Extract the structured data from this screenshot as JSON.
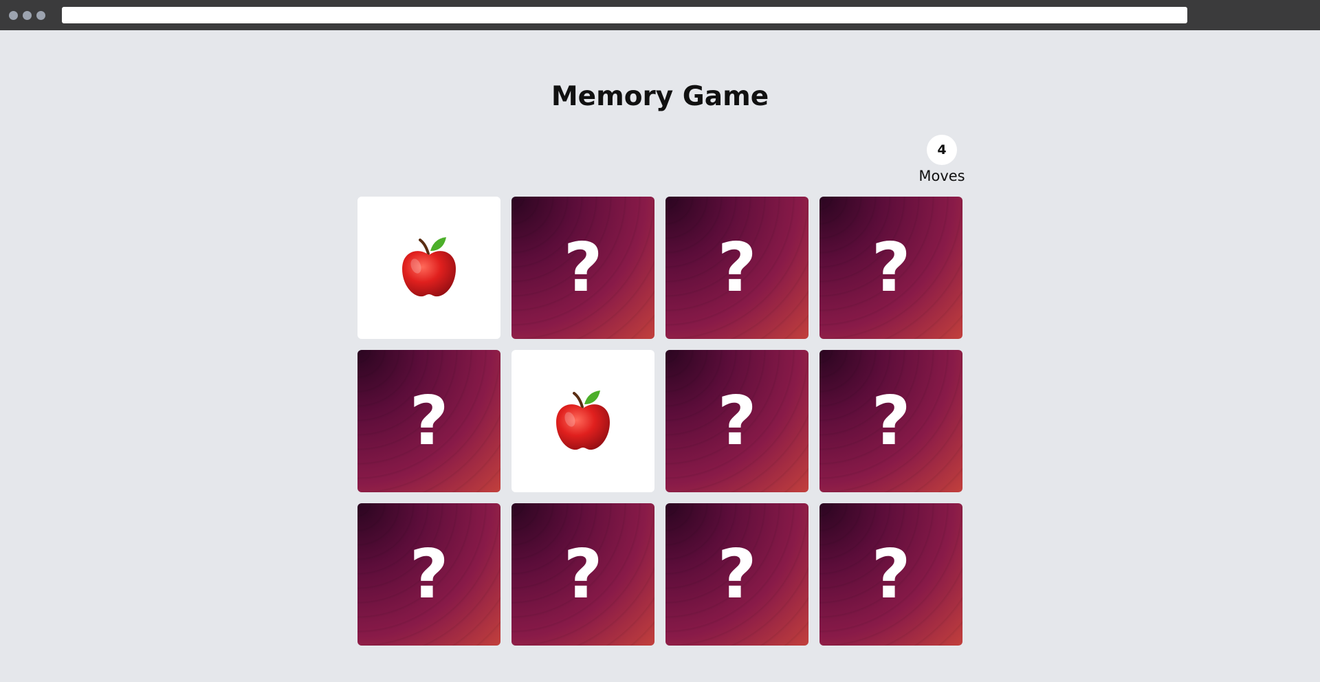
{
  "title": "Memory Game",
  "moves": {
    "count": "4",
    "label": "Moves"
  },
  "cards": [
    {
      "state": "revealed",
      "icon": "apple-icon",
      "symbol": "🍎"
    },
    {
      "state": "hidden",
      "symbol": "?"
    },
    {
      "state": "hidden",
      "symbol": "?"
    },
    {
      "state": "hidden",
      "symbol": "?"
    },
    {
      "state": "hidden",
      "symbol": "?"
    },
    {
      "state": "revealed",
      "icon": "apple-icon",
      "symbol": "🍎"
    },
    {
      "state": "hidden",
      "symbol": "?"
    },
    {
      "state": "hidden",
      "symbol": "?"
    },
    {
      "state": "hidden",
      "symbol": "?"
    },
    {
      "state": "hidden",
      "symbol": "?"
    },
    {
      "state": "hidden",
      "symbol": "?"
    },
    {
      "state": "hidden",
      "symbol": "?"
    }
  ],
  "colors": {
    "page_background": "#e5e7eb",
    "card_back_dark": "#2a0520",
    "card_back_mid": "#881a48",
    "card_back_light": "#c2403c",
    "card_front": "#ffffff"
  }
}
